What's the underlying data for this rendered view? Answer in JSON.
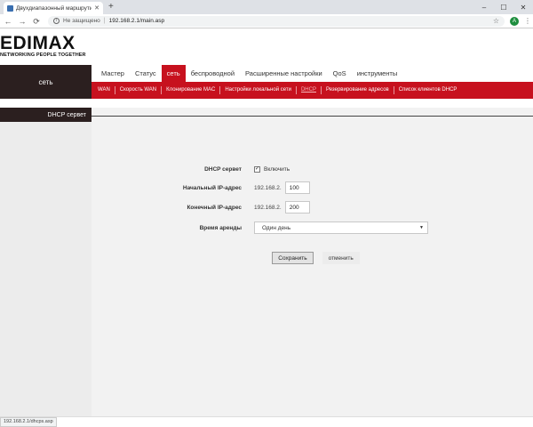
{
  "browser": {
    "tab_title": "Двухдиапазонный маршрутиз",
    "tab_close": "✕",
    "new_tab": "+",
    "minimize": "–",
    "maximize": "☐",
    "close": "✕",
    "back": "←",
    "forward": "→",
    "reload": "⟳",
    "security_text": "Не защищено",
    "separator": "|",
    "url": "192.168.2.1/main.asp",
    "star": "☆",
    "profile_initial": "A",
    "menu": "⋮",
    "status_url": "192.168.2.1/dhcps.asp"
  },
  "logo": {
    "name": "EDIMAX",
    "tagline": "NETWORKING PEOPLE TOGETHER"
  },
  "section_title": "сеть",
  "topnav": [
    {
      "label": "Мастер",
      "active": false
    },
    {
      "label": "Статус",
      "active": false
    },
    {
      "label": "сеть",
      "active": true
    },
    {
      "label": "беспроводной",
      "active": false
    },
    {
      "label": "Расширенные настройки",
      "active": false
    },
    {
      "label": "QoS",
      "active": false
    },
    {
      "label": "инструменты",
      "active": false
    }
  ],
  "subnav": [
    {
      "label": "WAN",
      "active": false
    },
    {
      "label": "Скорость WAN",
      "active": false
    },
    {
      "label": "Клонирование MAC",
      "active": false
    },
    {
      "label": "Настройки локальной сети",
      "active": false
    },
    {
      "label": "DHCP",
      "active": true
    },
    {
      "label": "Резервирование адресов",
      "active": false
    },
    {
      "label": "Список клиентов DHCP",
      "active": false
    }
  ],
  "sidebar": {
    "items": [
      {
        "label": "DHCP сервет"
      }
    ]
  },
  "form": {
    "dhcp_server": {
      "label": "DHCP сервет",
      "checked": true,
      "check_mark": "✓",
      "option_label": "Включить"
    },
    "start_ip": {
      "label": "Начальный IP-адрес",
      "prefix": "192.168.2.",
      "value": "100"
    },
    "end_ip": {
      "label": "Конечный IP-адрес",
      "prefix": "192.168.2.",
      "value": "200"
    },
    "lease_time": {
      "label": "Время аренды",
      "value": "Один день",
      "arrow": "▼"
    }
  },
  "buttons": {
    "save": "Сохранить",
    "cancel": "отменить"
  },
  "colors": {
    "accent_red": "#c7111e",
    "dark_brown": "#2b1f1f"
  }
}
